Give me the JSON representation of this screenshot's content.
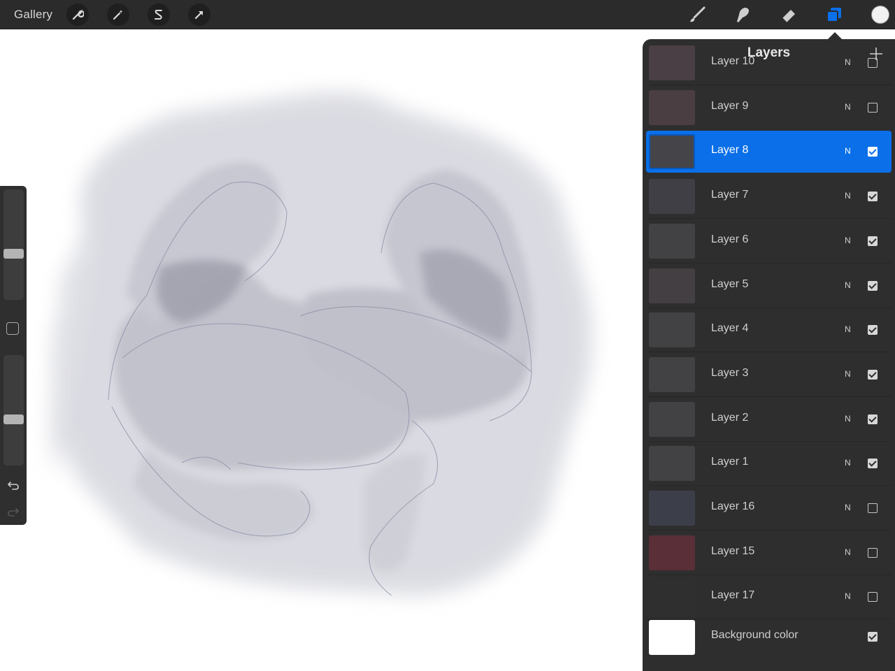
{
  "topbar": {
    "gallery_label": "Gallery",
    "left_tools": [
      {
        "icon": "wrench-icon"
      },
      {
        "icon": "magic-wand-icon"
      },
      {
        "icon": "selection-s-icon"
      },
      {
        "icon": "transform-arrow-icon"
      }
    ],
    "right_tools": [
      {
        "icon": "brush-icon"
      },
      {
        "icon": "smudge-icon"
      },
      {
        "icon": "eraser-icon"
      },
      {
        "icon": "layers-icon",
        "active": true
      }
    ],
    "current_color": "#f2f2f2"
  },
  "sidebar": {
    "brush_size_level": 0.41,
    "opacity_level": 0.41
  },
  "layers_panel": {
    "title": "Layers",
    "layers": [
      {
        "name": "Layer 10",
        "blend": "N",
        "visible": false,
        "selected": false
      },
      {
        "name": "Layer 9",
        "blend": "N",
        "visible": false,
        "selected": false
      },
      {
        "name": "Layer 8",
        "blend": "N",
        "visible": true,
        "selected": true
      },
      {
        "name": "Layer 7",
        "blend": "N",
        "visible": true,
        "selected": false
      },
      {
        "name": "Layer 6",
        "blend": "N",
        "visible": true,
        "selected": false
      },
      {
        "name": "Layer 5",
        "blend": "N",
        "visible": true,
        "selected": false
      },
      {
        "name": "Layer 4",
        "blend": "N",
        "visible": true,
        "selected": false
      },
      {
        "name": "Layer 3",
        "blend": "N",
        "visible": true,
        "selected": false
      },
      {
        "name": "Layer 2",
        "blend": "N",
        "visible": true,
        "selected": false
      },
      {
        "name": "Layer 1",
        "blend": "N",
        "visible": true,
        "selected": false
      },
      {
        "name": "Layer 16",
        "blend": "N",
        "visible": false,
        "selected": false
      },
      {
        "name": "Layer 15",
        "blend": "N",
        "visible": false,
        "selected": false
      },
      {
        "name": "Layer 17",
        "blend": "N",
        "visible": false,
        "selected": false
      }
    ],
    "background": {
      "name": "Background color",
      "visible": true,
      "color": "#ffffff"
    }
  },
  "colors": {
    "accent": "#0a6fe8",
    "toolbar_bg": "#2b2b2c",
    "panel_bg": "#2e2e2f"
  }
}
